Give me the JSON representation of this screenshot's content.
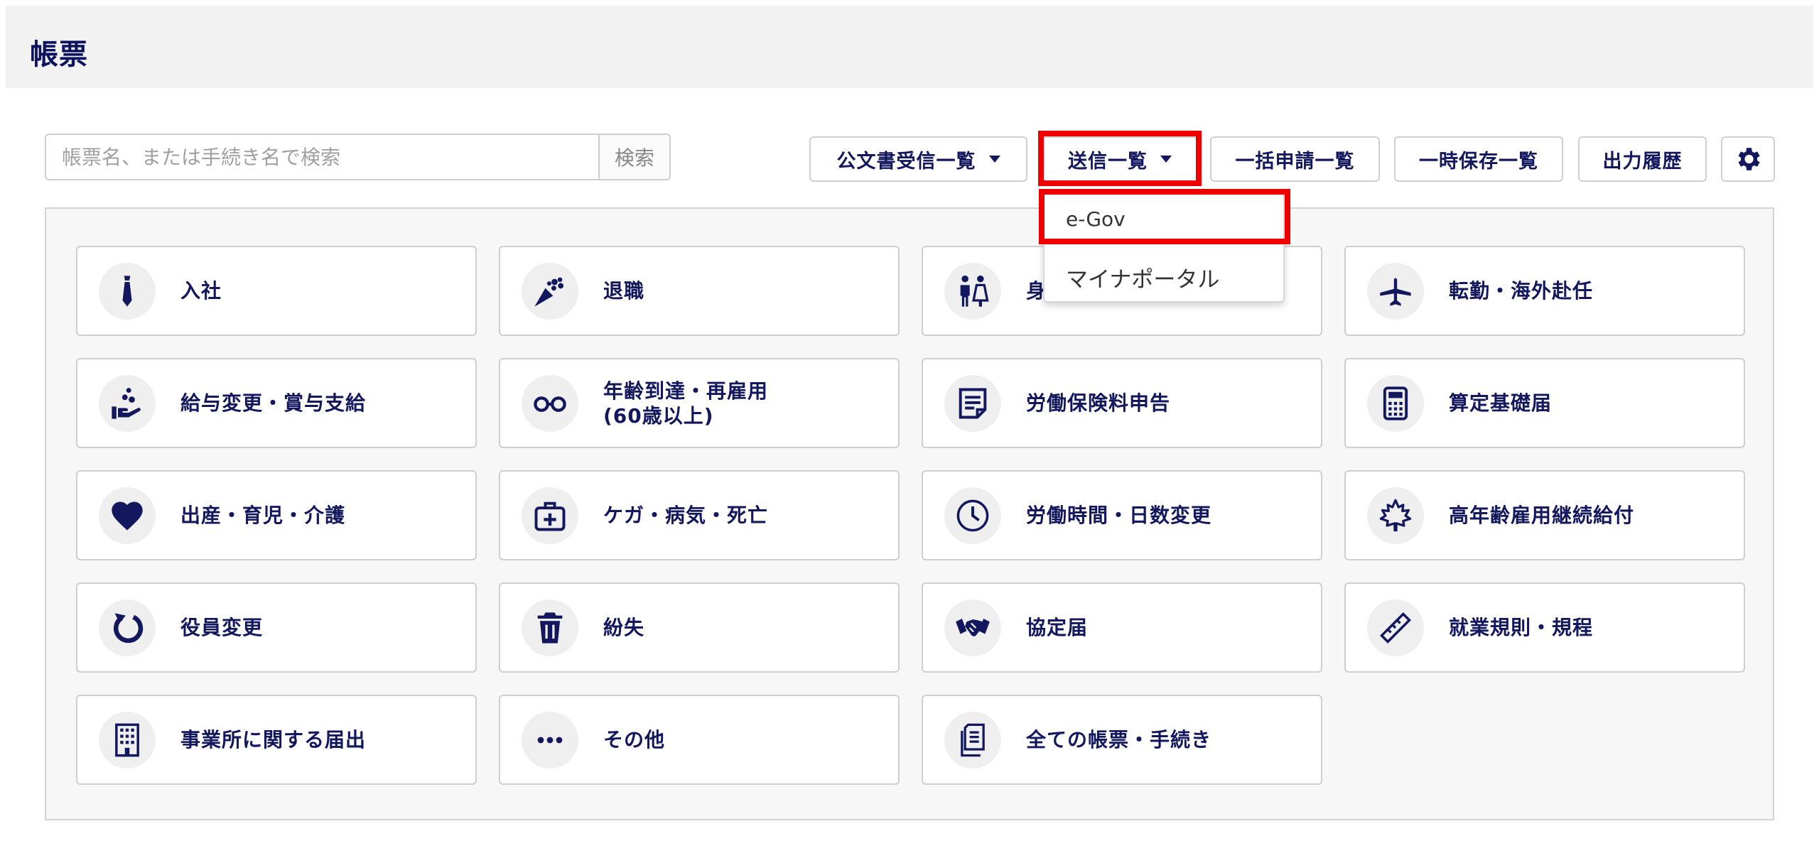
{
  "header": {
    "title": "帳票"
  },
  "search": {
    "placeholder": "帳票名、または手続き名で検索",
    "button_label": "検索"
  },
  "toolbar": {
    "kobunsho_label": "公文書受信一覧",
    "soshin_label": "送信一覧",
    "ikkatsu_label": "一括申請一覧",
    "ichiji_label": "一時保存一覧",
    "shutsuryoku_label": "出力履歴"
  },
  "dropdown": {
    "items": [
      {
        "label": "e-Gov"
      },
      {
        "label": "マイナポータル"
      }
    ]
  },
  "highlight_color": "#ee0000",
  "accent_color": "#12175e",
  "cards": [
    {
      "label": "入社",
      "icon": "necktie-icon"
    },
    {
      "label": "退職",
      "icon": "bouquet-icon"
    },
    {
      "label": "身",
      "icon": "couple-icon"
    },
    {
      "label": "転勤・海外赴任",
      "icon": "airplane-icon"
    },
    {
      "label": "給与変更・賞与支給",
      "icon": "hand-coins-icon"
    },
    {
      "label": "年齢到達・再雇用\n(60歳以上)",
      "icon": "glasses-icon"
    },
    {
      "label": "労働保険料申告",
      "icon": "document-icon"
    },
    {
      "label": "算定基礎届",
      "icon": "calculator-icon"
    },
    {
      "label": "出産・育児・介護",
      "icon": "heart-icon"
    },
    {
      "label": "ケガ・病気・死亡",
      "icon": "first-aid-kit-icon"
    },
    {
      "label": "労働時間・日数変更",
      "icon": "clock-icon"
    },
    {
      "label": "高年齢雇用継続給付",
      "icon": "maple-leaf-icon"
    },
    {
      "label": "役員変更",
      "icon": "refresh-icon"
    },
    {
      "label": "紛失",
      "icon": "trash-icon"
    },
    {
      "label": "協定届",
      "icon": "handshake-icon"
    },
    {
      "label": "就業規則・規程",
      "icon": "ruler-icon"
    },
    {
      "label": "事業所に関する届出",
      "icon": "building-icon"
    },
    {
      "label": "その他",
      "icon": "ellipsis-icon"
    },
    {
      "label": "全ての帳票・手続き",
      "icon": "documents-icon"
    }
  ]
}
